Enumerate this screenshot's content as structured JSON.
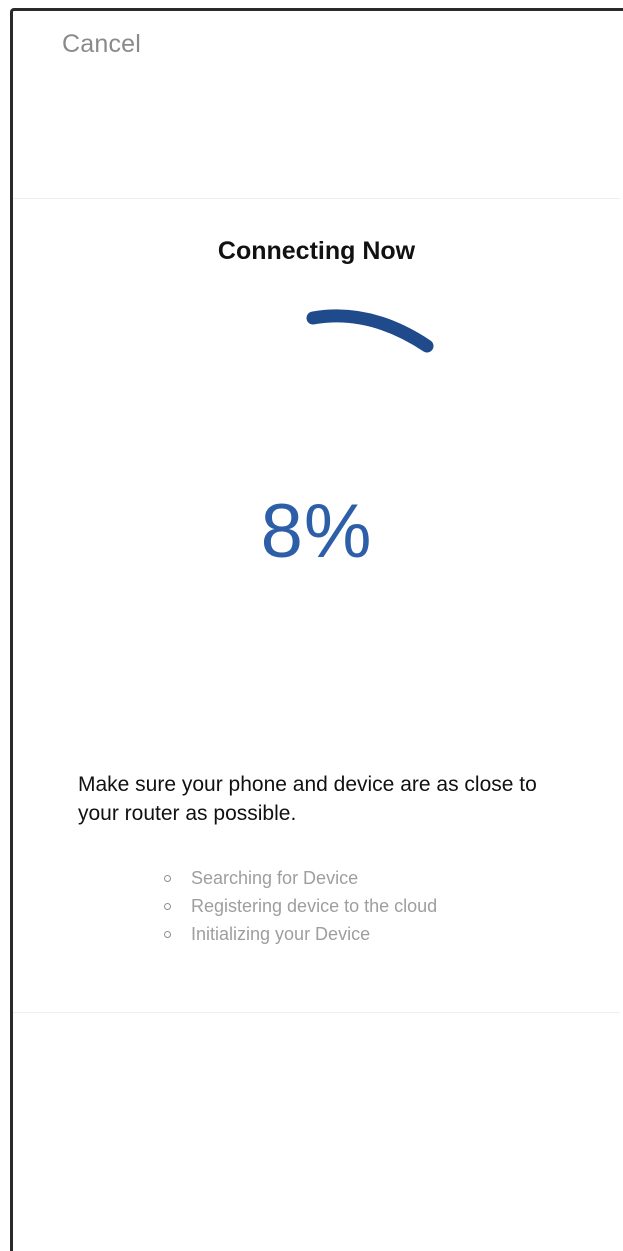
{
  "header": {
    "cancel_label": "Cancel"
  },
  "main": {
    "title": "Connecting Now",
    "progress_percent_label": "8%",
    "progress_value": 0.08,
    "tip": "Make sure your phone and device are as close to your router as possible.",
    "steps": [
      {
        "label": "Searching for Device"
      },
      {
        "label": "Registering device to the cloud"
      },
      {
        "label": "Initializing your Device"
      }
    ]
  },
  "colors": {
    "accent": "#2d5fa8",
    "muted_text": "#9e9e9e",
    "cancel_text": "#8a8a8a",
    "spinner": "#1f4a8c"
  },
  "icons": {
    "spinner": "loading-spinner-icon",
    "step_bullet": "circle-bullet-icon"
  }
}
